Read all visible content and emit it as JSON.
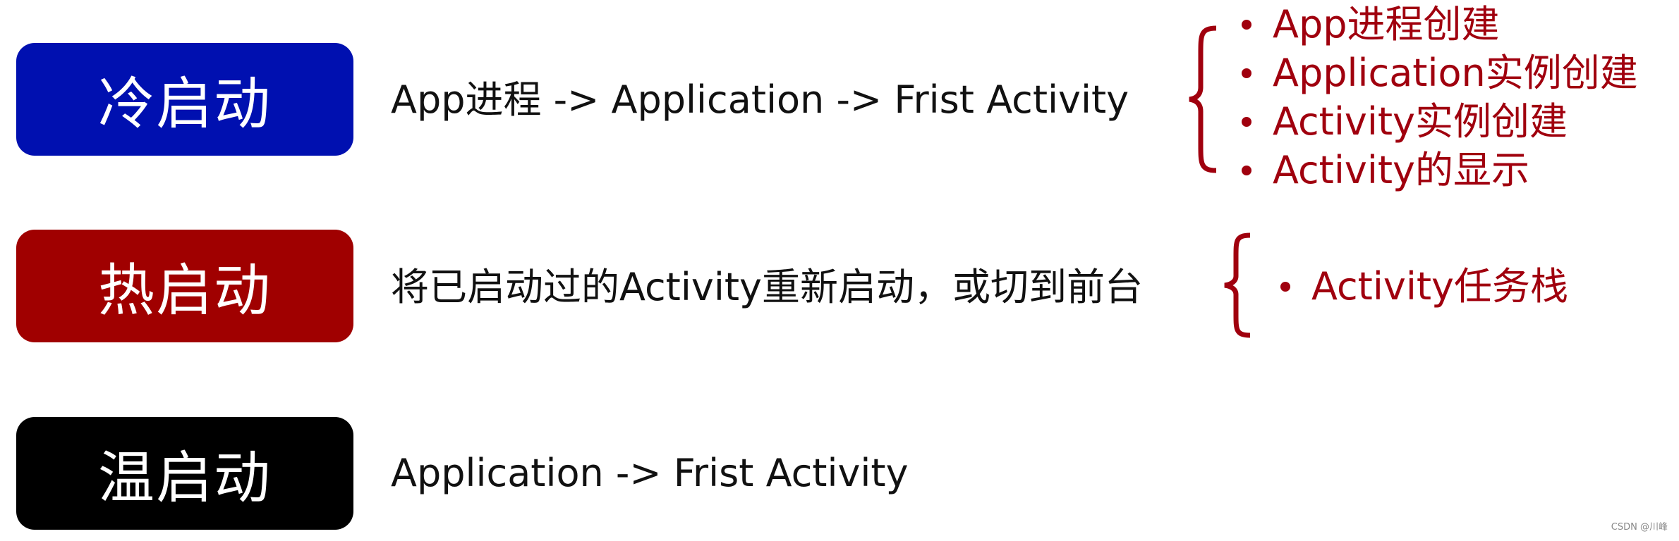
{
  "colors": {
    "cold": "#0010b0",
    "hot": "#a00000",
    "warm": "#000000",
    "accent": "#a0000e"
  },
  "rows": [
    {
      "label": "冷启动",
      "desc": "App进程 -> Application -> Frist Activity",
      "details": [
        "App进程创建",
        "Application实例创建",
        "Activity实例创建",
        "Activity的显示"
      ]
    },
    {
      "label": "热启动",
      "desc": "将已启动过的Activity重新启动，或切到前台",
      "details": [
        "Activity任务栈"
      ]
    },
    {
      "label": "温启动",
      "desc": "Application -> Frist Activity"
    }
  ],
  "watermark": "CSDN @川峰"
}
